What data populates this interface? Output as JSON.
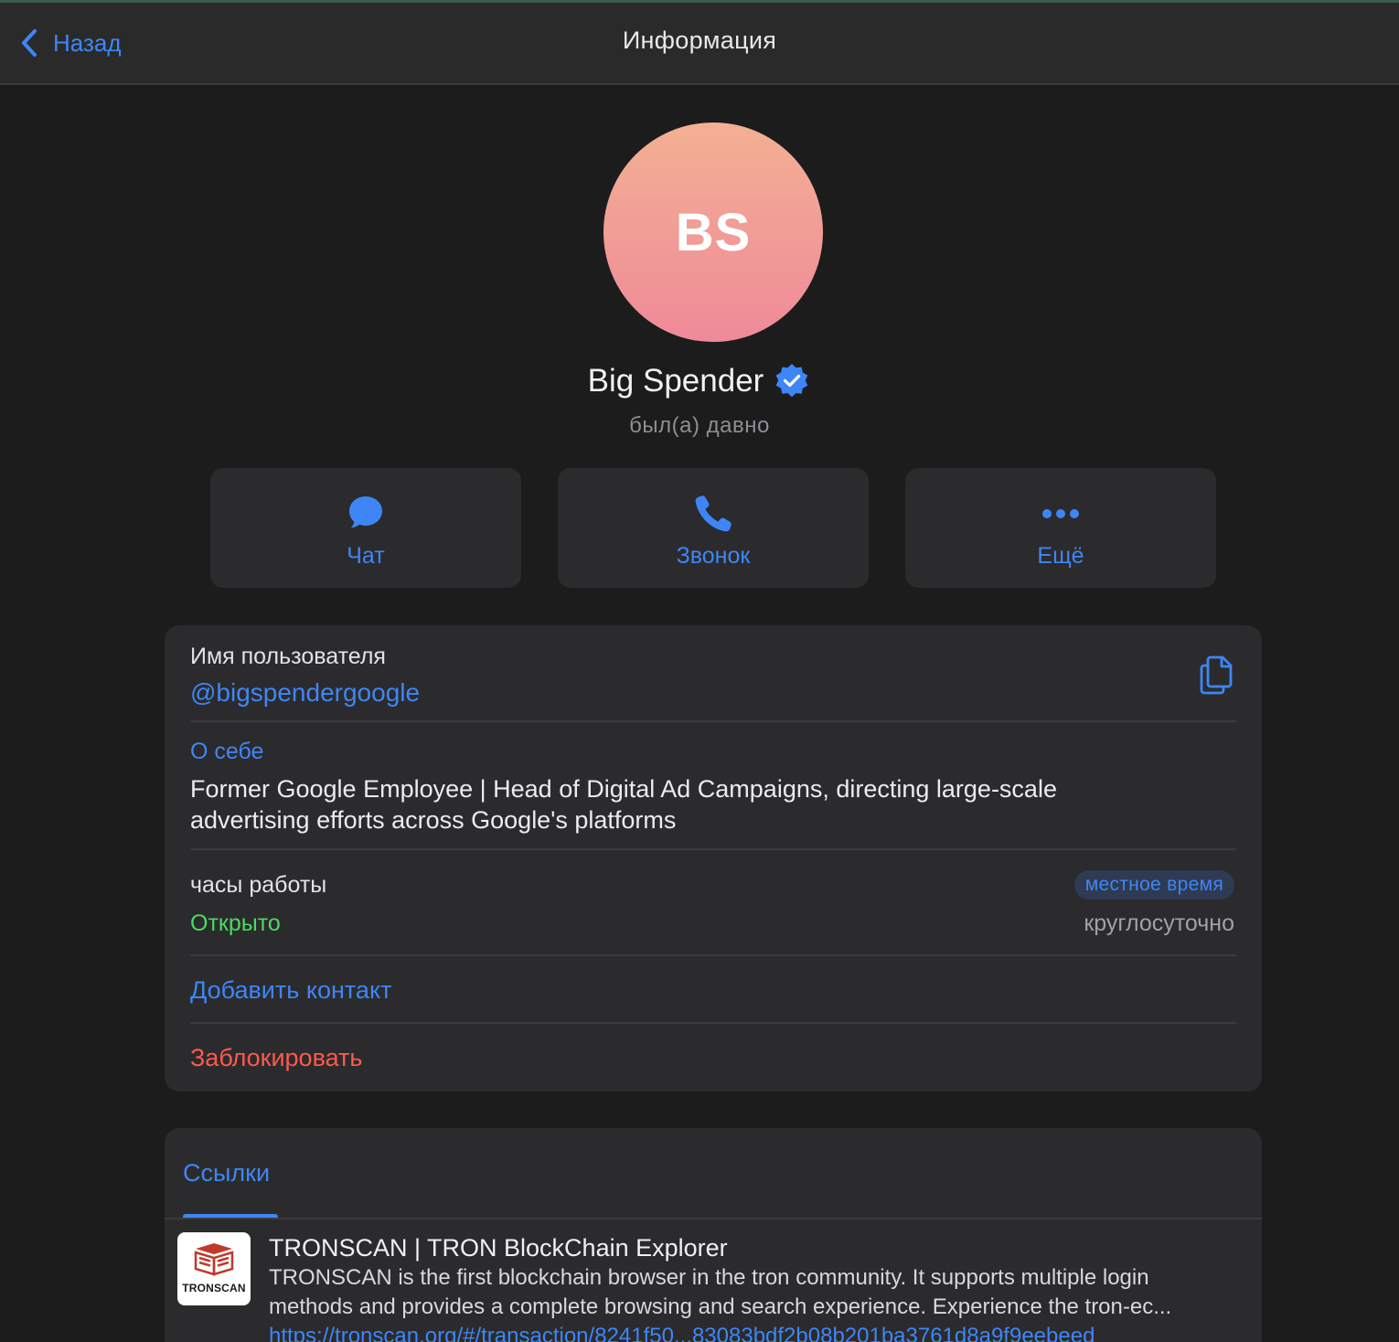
{
  "nav": {
    "back_label": "Назад",
    "title": "Информация"
  },
  "profile": {
    "initials": "BS",
    "name": "Big Spender",
    "status": "был(а) давно"
  },
  "actions": [
    {
      "label": "Чат",
      "icon": "chat-bubble-icon"
    },
    {
      "label": "Звонок",
      "icon": "phone-icon"
    },
    {
      "label": "Ещё",
      "icon": "more-dots-icon"
    }
  ],
  "info": {
    "username_label": "Имя пользователя",
    "username": "@bigspendergoogle",
    "about_label": "О себе",
    "about_line1": "Former Google Employee | Head of Digital Ad Campaigns, directing large-scale",
    "about_line2": "advertising efforts across Google's platforms",
    "hours_label": "часы работы",
    "local_time_badge": "местное время",
    "open_status": "Открыто",
    "hours_value": "круглосуточно",
    "add_contact": "Добавить контакт",
    "block": "Заблокировать"
  },
  "links": {
    "tab_label": "Ссылки",
    "items": [
      {
        "thumb_label": "TRONSCAN",
        "title": "TRONSCAN | TRON BlockChain Explorer",
        "desc_line1": "TRONSCAN is the first blockchain browser in the tron community. It supports multiple login",
        "desc_line2": "methods and provides a complete browsing and search experience. Experience the tron-ec...",
        "url": "https://tronscan.org/#/transaction/8241f50...83083bdf2b08b201ba3761d8a9f9eebeed"
      }
    ]
  },
  "colors": {
    "accent": "#3e86f6",
    "open_green": "#4cd964",
    "block_red": "#ff5a4e",
    "background": "#1c1c1d",
    "card": "#2b2b2d"
  }
}
